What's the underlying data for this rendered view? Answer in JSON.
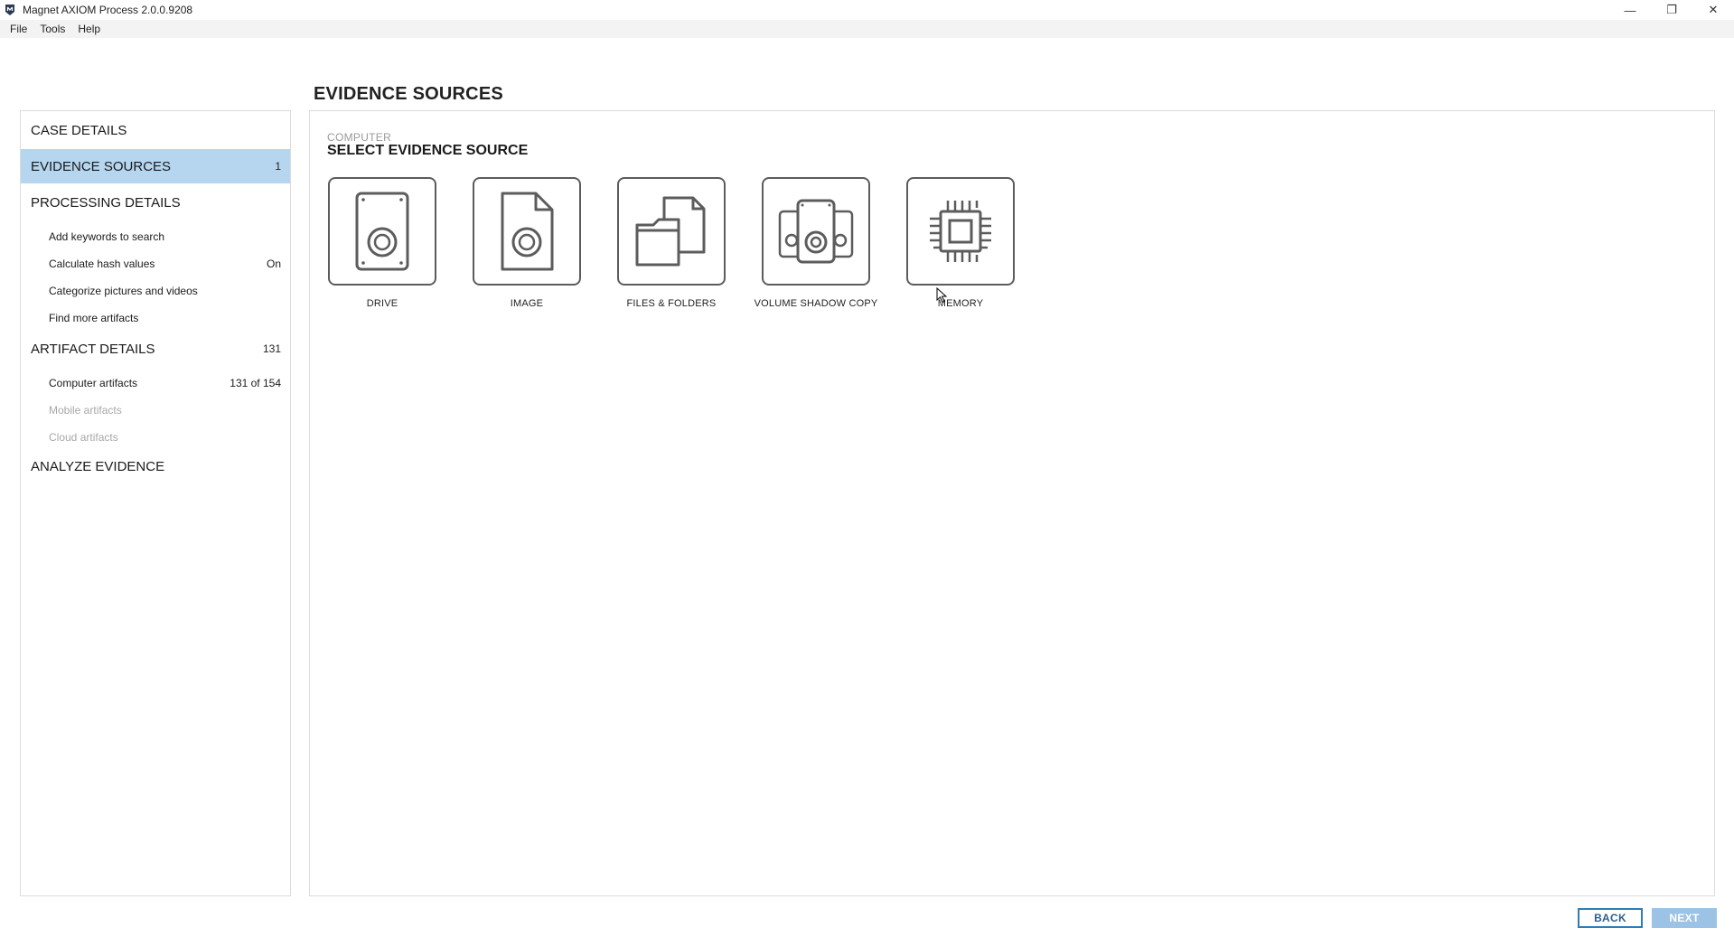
{
  "window": {
    "title": "Magnet AXIOM Process 2.0.0.9208",
    "icon": "magnet-axiom-icon",
    "controls": {
      "minimize": "—",
      "restore": "❐",
      "close": "✕"
    }
  },
  "menu": [
    {
      "label": "File"
    },
    {
      "label": "Tools"
    },
    {
      "label": "Help"
    }
  ],
  "page_title": "EVIDENCE SOURCES",
  "sidebar": {
    "sections": [
      {
        "label": "CASE DETAILS",
        "count": ""
      },
      {
        "label": "EVIDENCE SOURCES",
        "count": "1",
        "active": true
      },
      {
        "label": "PROCESSING DETAILS",
        "count": ""
      },
      {
        "label": "ARTIFACT DETAILS",
        "count": "131"
      },
      {
        "label": "ANALYZE EVIDENCE",
        "count": ""
      }
    ],
    "processing_items": [
      {
        "label": "Add keywords to search",
        "value": ""
      },
      {
        "label": "Calculate hash values",
        "value": "On"
      },
      {
        "label": "Categorize pictures and videos",
        "value": ""
      },
      {
        "label": "Find more artifacts",
        "value": ""
      }
    ],
    "artifact_items": [
      {
        "label": "Computer artifacts",
        "value": "131 of 154",
        "disabled": false
      },
      {
        "label": "Mobile artifacts",
        "value": "",
        "disabled": true
      },
      {
        "label": "Cloud artifacts",
        "value": "",
        "disabled": true
      }
    ]
  },
  "main": {
    "kicker": "COMPUTER",
    "title": "SELECT EVIDENCE SOURCE",
    "sources": [
      {
        "label": "DRIVE",
        "icon": "drive-icon"
      },
      {
        "label": "IMAGE",
        "icon": "image-file-icon"
      },
      {
        "label": "FILES & FOLDERS",
        "icon": "files-folders-icon"
      },
      {
        "label": "VOLUME SHADOW COPY",
        "icon": "volume-shadow-copy-icon"
      },
      {
        "label": "MEMORY",
        "icon": "memory-chip-icon"
      }
    ]
  },
  "footer": {
    "back_label": "BACK",
    "next_label": "NEXT"
  },
  "colors": {
    "active_nav": "#b5d6ee",
    "back_border": "#2e7cb8",
    "next_bg": "#9cc3e6",
    "icon_stroke": "#5c5c5c"
  }
}
